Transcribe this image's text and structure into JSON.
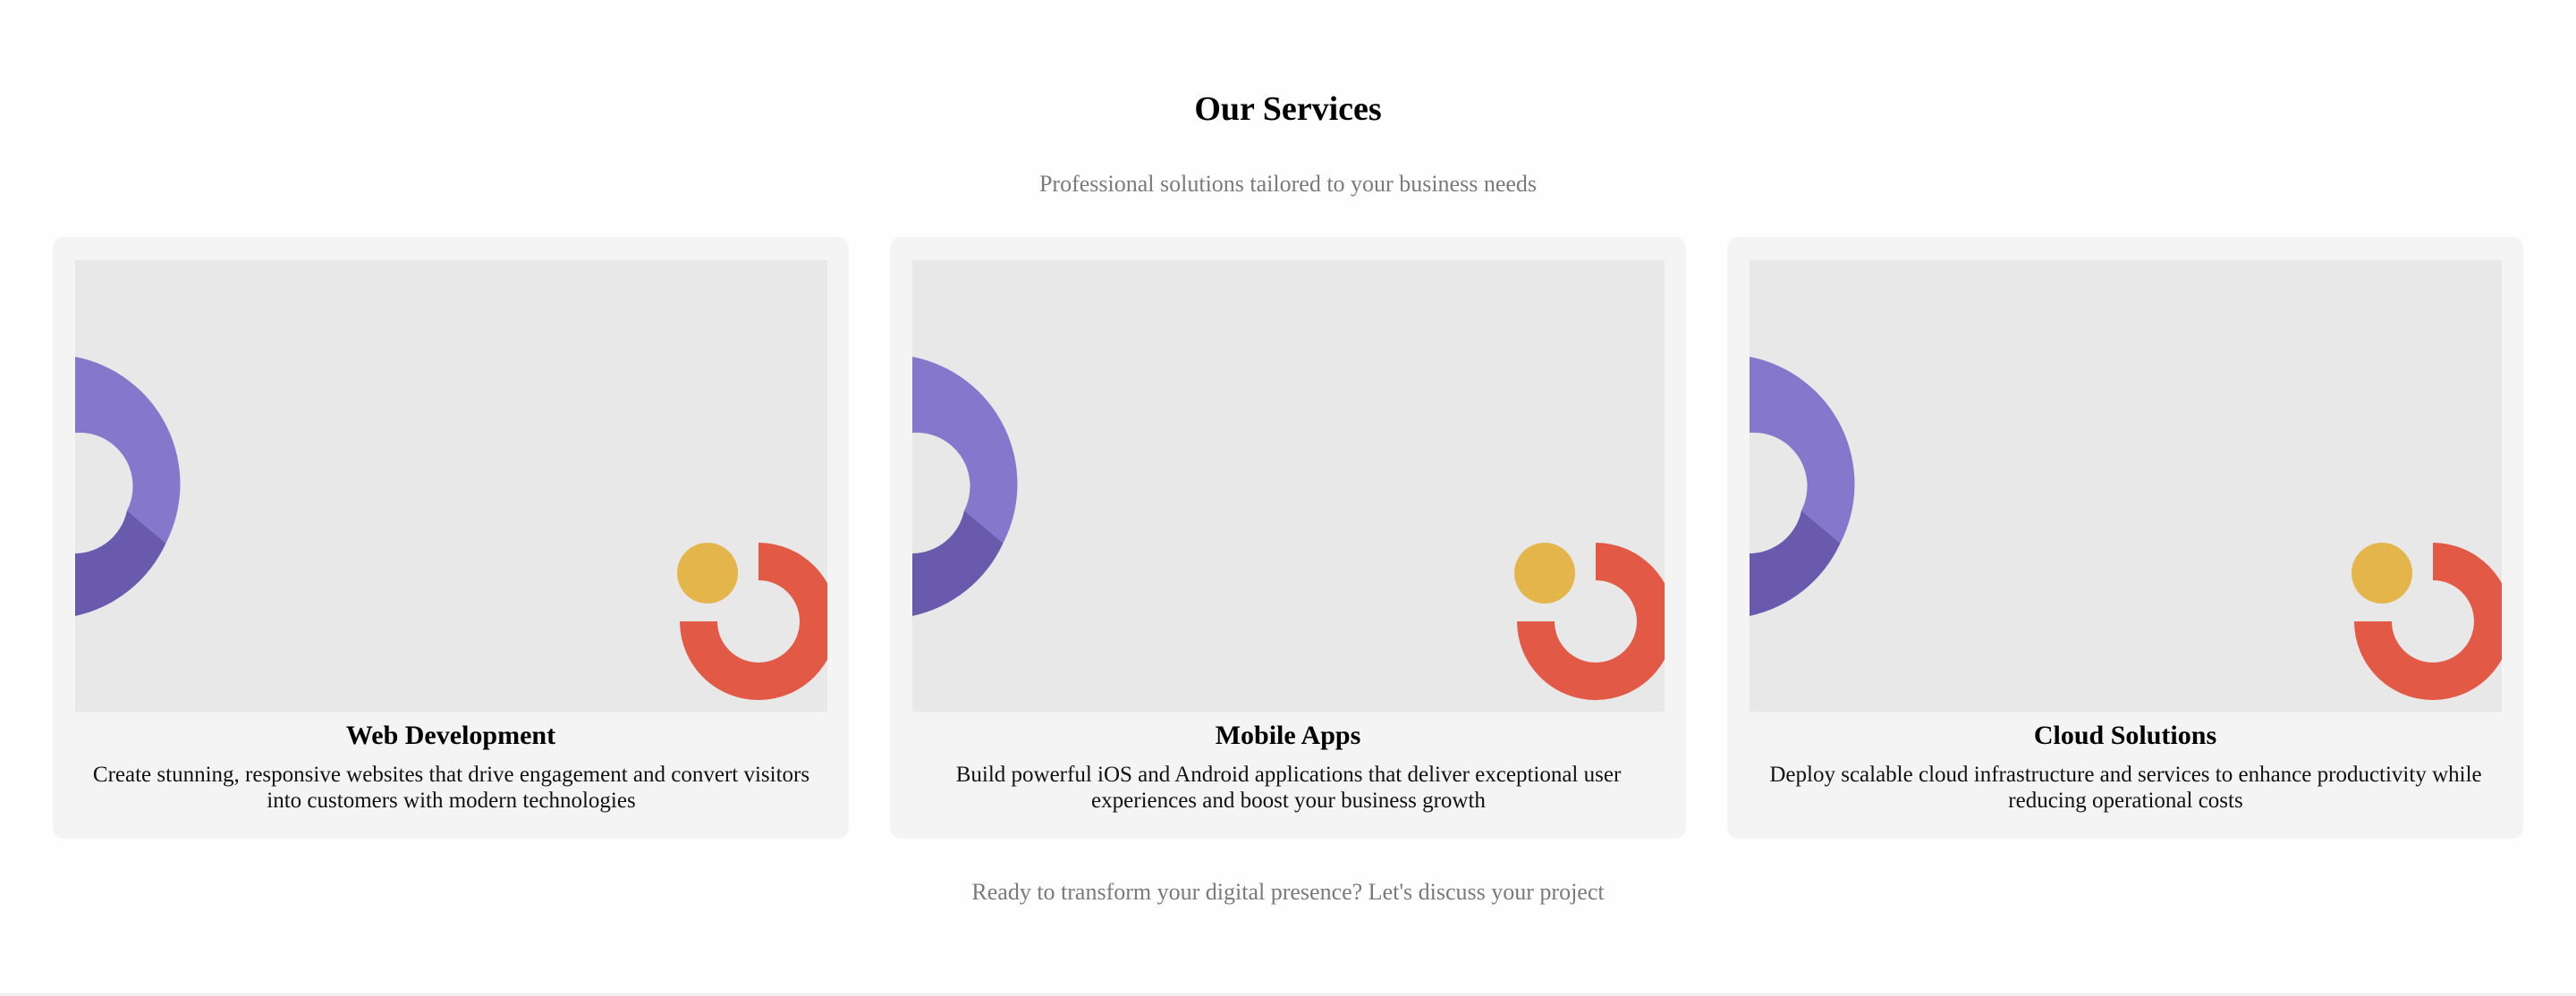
{
  "header": {
    "title": "Our Services",
    "subtitle": "Professional solutions tailored to your business needs"
  },
  "services": [
    {
      "title": "Web Development",
      "description": "Create stunning, responsive websites that drive engagement and convert visitors into customers with modern technologies"
    },
    {
      "title": "Mobile Apps",
      "description": "Build powerful iOS and Android applications that deliver exceptional user experiences and boost your business growth"
    },
    {
      "title": "Cloud Solutions",
      "description": "Deploy scalable cloud infrastructure and services to enhance productivity while reducing operational costs"
    }
  ],
  "footer": {
    "cta_text": "Ready to transform your digital presence? Let's discuss your project"
  },
  "colors": {
    "page_background": "#fefefe",
    "card_background": "#f4f4f4",
    "image_background": "#e8e8e8",
    "purple_light": "#8577cc",
    "purple_dark": "#6a5aad",
    "yellow": "#e3b54b",
    "red": "#e25a45",
    "muted_text": "#7a7a7a"
  },
  "icons": {
    "illustration": "abstract-shapes-illustration"
  }
}
